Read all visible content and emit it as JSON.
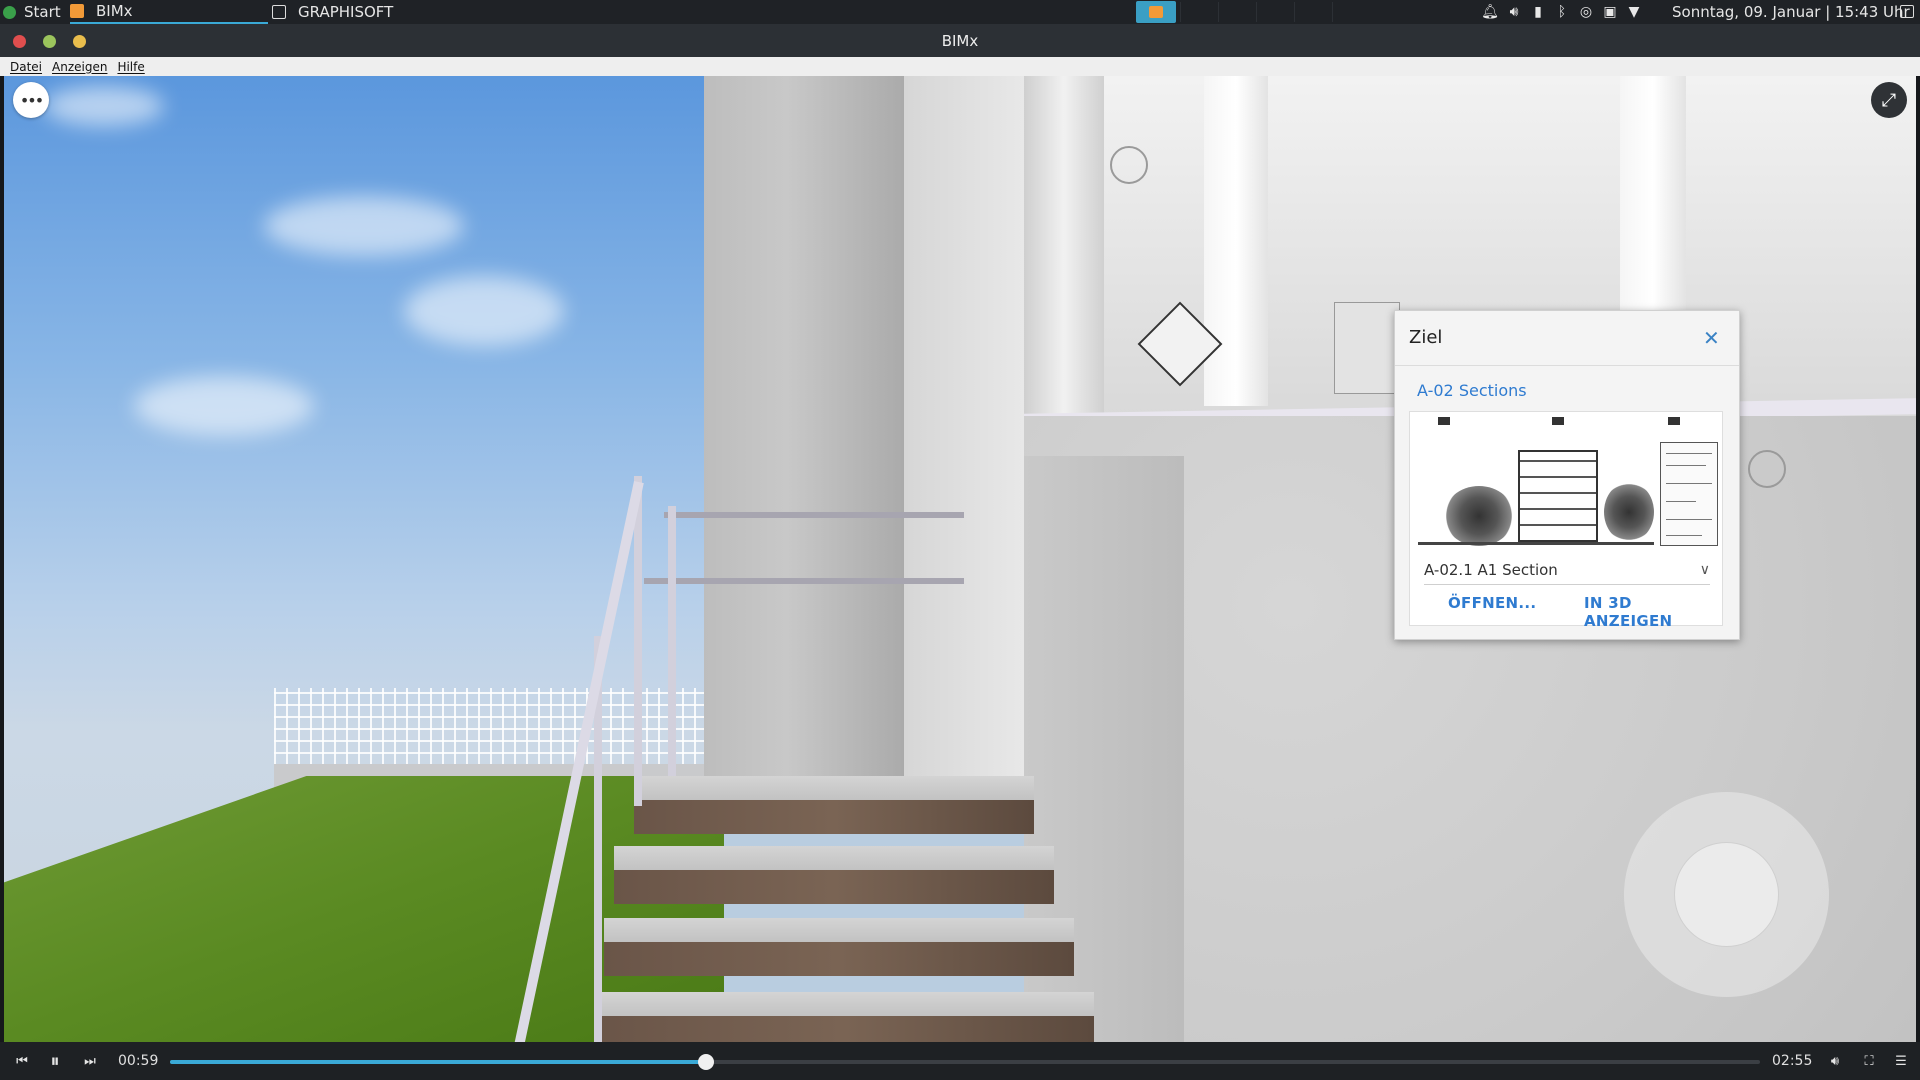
{
  "taskbar": {
    "start_label": "Start",
    "tasks": [
      {
        "label": "BIMx",
        "icon": "bimx-app-icon",
        "active": true
      },
      {
        "label": "GRAPHISOFT",
        "icon": "folder-icon",
        "active": false
      }
    ],
    "clock": "Sonntag, 09. Januar | 15:43 Uhr",
    "tray_icons": [
      "bell-icon",
      "volume-icon",
      "battery-icon",
      "bluetooth-icon",
      "network-icon",
      "calendar-icon",
      "wifi-icon"
    ]
  },
  "window": {
    "title": "BIMx"
  },
  "menu": {
    "items": [
      "Datei",
      "Anzeigen",
      "Hilfe"
    ]
  },
  "viewport": {
    "more_button_icon": "more-horizontal-icon",
    "fullscreen_icon": "expand-icon"
  },
  "popup": {
    "title": "Ziel",
    "close_icon": "close-icon",
    "link": "A-02 Sections",
    "card": {
      "selected_view": "A-02.1 A1 Section",
      "open_button": "ÖFFNEN...",
      "show3d_button": "IN 3D ANZEIGEN"
    }
  },
  "player": {
    "current_time": "00:59",
    "total_time": "02:55",
    "progress": 0.337,
    "accent": "#3aa9d6"
  }
}
